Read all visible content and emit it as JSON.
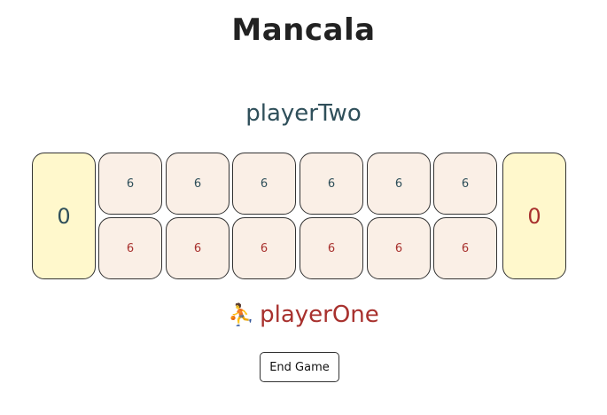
{
  "title": "Mancala",
  "players": {
    "top": "playerTwo",
    "bottom": "playerOne",
    "active_indicator": "⛹"
  },
  "stores": {
    "left": "0",
    "right": "0"
  },
  "pits": {
    "top": [
      "6",
      "6",
      "6",
      "6",
      "6",
      "6"
    ],
    "bottom": [
      "6",
      "6",
      "6",
      "6",
      "6",
      "6"
    ]
  },
  "controls": {
    "end_game_label": "End Game"
  },
  "colors": {
    "player_two_text": "#2f4f5a",
    "player_one_text": "#a8312e",
    "store_fill": "#fff8cc",
    "pit_fill": "#faefe6"
  }
}
